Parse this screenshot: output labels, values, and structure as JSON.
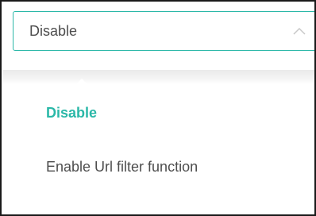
{
  "select": {
    "value": "Disable",
    "accent_color": "#2bb8a8",
    "expanded_icon": "chevron-up-icon"
  },
  "options": [
    {
      "label": "Disable",
      "selected": true
    },
    {
      "label": "Enable Url filter function",
      "selected": false
    }
  ]
}
